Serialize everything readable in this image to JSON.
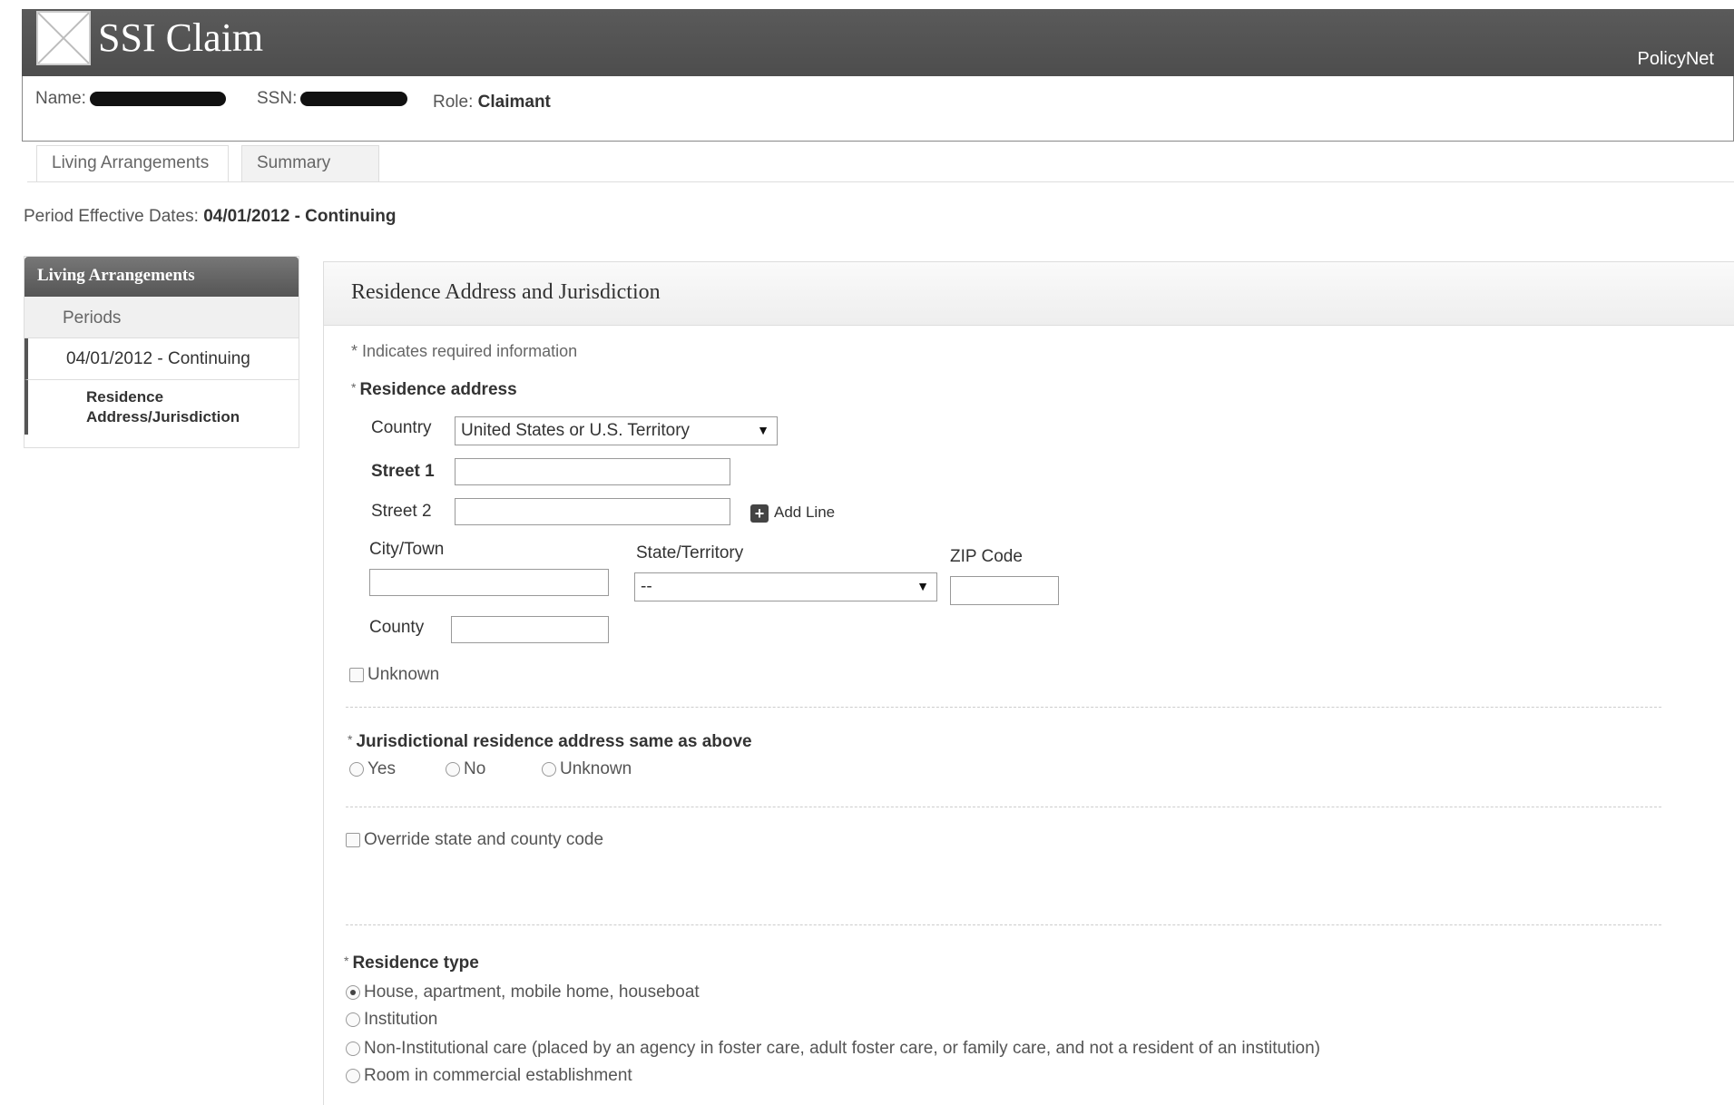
{
  "header": {
    "title": "SSI Claim",
    "brand": "PolicyNet"
  },
  "id_bar": {
    "name_label": "Name:",
    "ssn_label": "SSN:",
    "role_label": "Role:",
    "role_value": "Claimant"
  },
  "tabs": [
    {
      "label": "Living Arrangements",
      "active": true
    },
    {
      "label": "Summary",
      "active": false
    }
  ],
  "period": {
    "label": "Period Effective Dates:",
    "dates": "04/01/2012",
    "status": "- Continuing"
  },
  "leftnav": {
    "heading": "Living Arrangements",
    "periods_label": "Periods",
    "period_item": "04/01/2012 - Continuing",
    "sub_item_line1": "Residence",
    "sub_item_line2": "Address/Jurisdiction"
  },
  "panel": {
    "title": "Residence Address and Jurisdiction",
    "required_note": "* Indicates required information",
    "residence_address": {
      "heading": "Residence address",
      "country_label": "Country",
      "country_value": "United States or U.S. Territory",
      "street1_label": "Street 1",
      "street1_value": "",
      "street2_label": "Street 2",
      "street2_value": "",
      "add_line_label": "Add Line",
      "city_label": "City/Town",
      "city_value": "",
      "state_label": "State/Territory",
      "state_value": "--",
      "zip_label": "ZIP Code",
      "zip_value": "",
      "county_label": "County",
      "county_value": "",
      "unknown_label": "Unknown"
    },
    "jurisdiction": {
      "heading": "Jurisdictional residence address same as above",
      "options": [
        "Yes",
        "No",
        "Unknown"
      ]
    },
    "override_label": "Override state and county code",
    "residence_type": {
      "heading": "Residence type",
      "options": [
        "House, apartment, mobile home, houseboat",
        "Institution",
        "Non-Institutional care (placed by an agency in foster care, adult foster care, or family care, and not a resident of an institution)",
        "Room in commercial establishment"
      ],
      "selected_index": 0
    }
  }
}
